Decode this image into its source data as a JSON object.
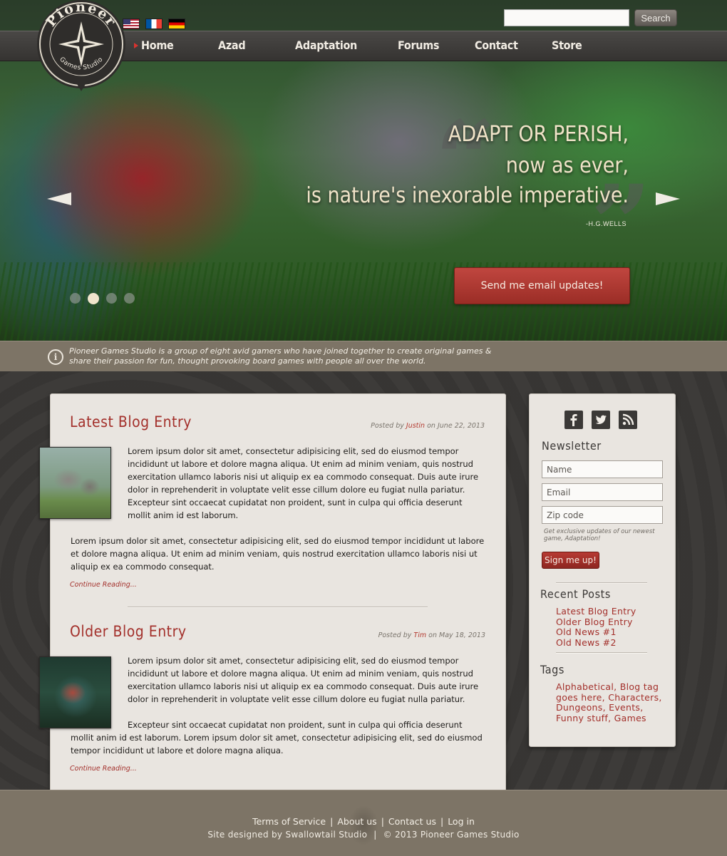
{
  "header": {
    "logo": {
      "name": "Pioneer",
      "subtitle": "Games Studio"
    },
    "flags": [
      "us-flag",
      "fr-flag",
      "de-flag"
    ],
    "search": {
      "placeholder": "",
      "button_label": "Search"
    },
    "nav": {
      "active": "Home",
      "items": [
        {
          "label": "Home"
        },
        {
          "label": "Azad"
        },
        {
          "label": "Adaptation"
        },
        {
          "label": "Forums"
        },
        {
          "label": "Contact"
        },
        {
          "label": "Store"
        }
      ]
    }
  },
  "hero": {
    "quote_lines": [
      "ADAPT OR PERISH,",
      "now as ever,",
      "is nature's inexorable imperative."
    ],
    "quote_author": "-H.G.WELLS",
    "cta_label": "Send me email updates!",
    "slider": {
      "slide_count": 4,
      "active_slide": 2
    },
    "prev_icon": "left-arrow-icon",
    "next_icon": "right-arrow-icon"
  },
  "info": {
    "icon": "info-icon",
    "text": "Pioneer Games Studio is a group of eight avid gamers who have joined together to create original games & share their passion for fun, thought provoking board games with people all over the world."
  },
  "posts": [
    {
      "title": "Latest Blog Entry",
      "meta_prefix": "Posted by",
      "author": "Justin",
      "meta_on": "on",
      "date": "June 22, 2013",
      "paragraphs": [
        "Lorem ipsum dolor sit amet, consectetur adipisicing elit, sed do eiusmod tempor incididunt ut labore et dolore magna aliqua. Ut enim ad minim veniam, quis nostrud exercitation ullamco laboris nisi ut aliquip ex ea commodo consequat. Duis aute irure dolor in reprehenderit in voluptate velit esse cillum dolore eu fugiat nulla pariatur. Excepteur sint occaecat cupidatat non proident, sunt in culpa qui officia deserunt mollit anim id est laborum.",
        "Lorem ipsum dolor sit amet, consectetur adipisicing elit, sed do eiusmod tempor incididunt ut labore et dolore magna aliqua. Ut enim ad minim veniam, quis nostrud exercitation ullamco laboris nisi ut aliquip ex ea commodo consequat."
      ],
      "continue_label": "Continue Reading..."
    },
    {
      "title": "Older Blog Entry",
      "meta_prefix": "Posted by",
      "author": "Tim",
      "meta_on": "on",
      "date": "May 18, 2013",
      "paragraphs": [
        "Lorem ipsum dolor sit amet, consectetur adipisicing elit, sed do eiusmod tempor incididunt ut labore et dolore magna aliqua. Ut enim ad minim veniam, quis nostrud exercitation ullamco laboris nisi ut aliquip ex ea commodo consequat. Duis aute irure dolor in reprehenderit in voluptate velit esse cillum dolore eu fugiat nulla pariatur.",
        "Excepteur sint occaecat cupidatat non proident, sunt in culpa qui officia deserunt mollit anim id est laborum.  Lorem ipsum dolor sit amet, consectetur adipisicing elit, sed do eiusmod tempor incididunt ut labore et dolore magna aliqua."
      ],
      "continue_label": "Continue Reading..."
    }
  ],
  "sidebar": {
    "social": [
      "facebook-icon",
      "twitter-icon",
      "rss-icon"
    ],
    "newsletter": {
      "heading": "Newsletter",
      "name_placeholder": "Name",
      "email_placeholder": "Email",
      "zip_placeholder": "Zip code",
      "note": "Get exclusive updates of our newest game, Adaptation!",
      "button_label": "Sign me up!"
    },
    "recent": {
      "heading": "Recent Posts",
      "items": [
        "Latest Blog Entry",
        "Older Blog Entry",
        "Old News #1",
        "Old News #2"
      ]
    },
    "tags": {
      "heading": "Tags",
      "items": [
        "Alphabetical",
        "Blog tag goes here",
        "Characters",
        "Dungeons",
        "Events",
        "Funny stuff",
        "Games"
      ]
    }
  },
  "footer": {
    "links": [
      "Terms of Service",
      "About us",
      "Contact us",
      "Log in"
    ],
    "separator": "|",
    "credits": [
      "Site designed by Swallowtail Studio",
      "© 2013 Pioneer Games Studio"
    ]
  },
  "colors": {
    "accent_red": "#a3302b",
    "nav_bg": "#3f3d3b",
    "panel_bg": "#e9e5e0",
    "band_bg": "#7d7466",
    "cta_red": "#b03a34"
  }
}
